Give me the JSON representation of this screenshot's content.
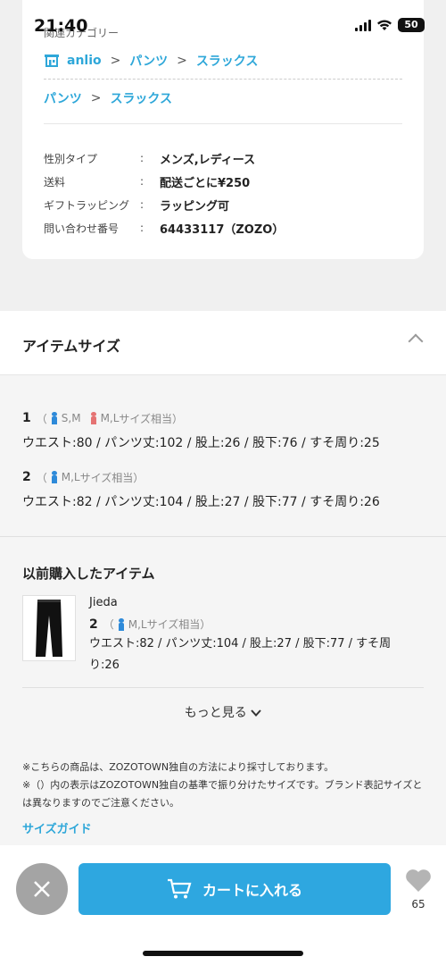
{
  "status_bar": {
    "time": "21:40",
    "battery": "50"
  },
  "product_info": {
    "related_label": "関連カテゴリー",
    "brand_breadcrumb": [
      "anlio",
      "パンツ",
      "スラックス"
    ],
    "category_breadcrumb": [
      "パンツ",
      "スラックス"
    ],
    "breadcrumb_separator": ">",
    "colon": ":",
    "specs": [
      {
        "key": "性別タイプ",
        "value": "メンズ,レディース"
      },
      {
        "key": "送料",
        "value": "配送ごとに¥250"
      },
      {
        "key": "ギフトラッピング",
        "value": "ラッピング可"
      },
      {
        "key": "問い合わせ番号",
        "value": "64433117（ZOZO）"
      }
    ]
  },
  "item_size": {
    "title": "アイテムサイズ",
    "sizes": [
      {
        "num": "1",
        "paren_open": "（",
        "male_label": "S,M",
        "female_label": "M,L",
        "suffix": "サイズ相当）",
        "measure": "ウエスト:80 / パンツ丈:102 / 股上:26 / 股下:76 / すそ周り:25"
      },
      {
        "num": "2",
        "paren_open": "（",
        "male_label": "M,L",
        "suffix": "サイズ相当）",
        "measure": "ウエスト:82 / パンツ丈:104 / 股上:27 / 股下:77 / すそ周り:26"
      }
    ]
  },
  "previous_items": {
    "title": "以前購入したアイテム",
    "item": {
      "brand": "Jieda",
      "num": "2",
      "paren_open": "（",
      "male_label": "M,L",
      "suffix": "サイズ相当）",
      "measure": "ウエスト:82 / パンツ丈:104 / 股上:27 / 股下:77 / すそ周り:26"
    },
    "more_label": "もっと見る",
    "notes": [
      "※こちらの商品は、ZOZOTOWN独自の方法により採寸しております。",
      "※（）内の表示はZOZOTOWN独自の基準で振り分けたサイズです。ブランド表記サイズとは異なりますのでご注意ください。"
    ],
    "size_guide": "サイズガイド"
  },
  "bottom_bar": {
    "cart_label": "カートに入れる",
    "fav_count": "65"
  },
  "colors": {
    "accent": "#2ea7e0",
    "link": "#2ea7d9",
    "male": "#2e8ad9",
    "female": "#e57373",
    "close": "#a4a4a4"
  }
}
